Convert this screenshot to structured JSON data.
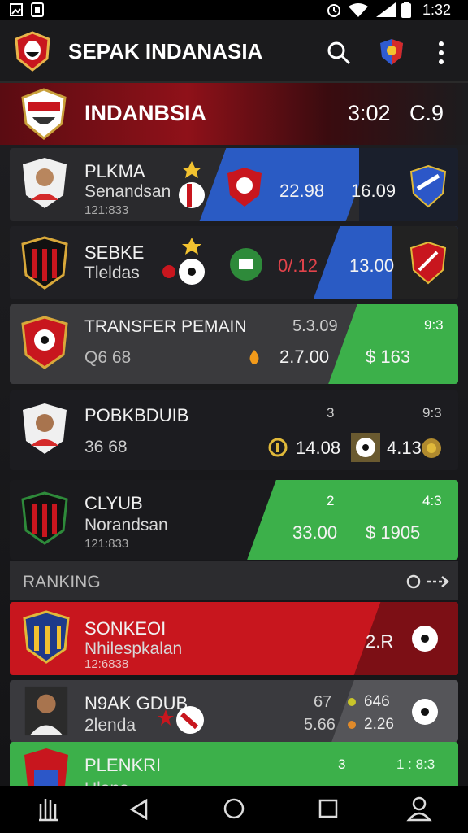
{
  "status_bar": {
    "time": "1:32"
  },
  "app_bar": {
    "title": "SEPAK INDANASIA"
  },
  "banner": {
    "title": "INDANBSIA",
    "score_left": "3:02",
    "score_right": "C.9"
  },
  "cards": [
    {
      "line1": "PLKMA",
      "line2": "Senandsan",
      "line3": "121:833",
      "value1": "22.98",
      "value2": "16.09"
    },
    {
      "line1": "SEBKE",
      "line2": "Tleldas",
      "value1": "0/.12",
      "value2": "13.00"
    },
    {
      "line1": "TRANSFER PEMAIN",
      "line2": "Q6 68",
      "top_value": "5.3.09",
      "value1": "2.7.00",
      "green_top": "9:3",
      "green_value": "$ 163"
    },
    {
      "line1": "POBKBDUIB",
      "line2": "36 68",
      "top_mid": "3",
      "top_right": "9:3",
      "value1": "14.08",
      "value2": "4.13"
    },
    {
      "line1": "CLYUB",
      "line2": "Norandsan",
      "line3": "121:833",
      "green_top": "2",
      "green_top2": "4:3",
      "green_value1": "33.00",
      "green_value2": "$ 1905"
    }
  ],
  "ranking": {
    "header": "RANKING",
    "items": [
      {
        "line1": "SONKEOI",
        "line2": "Nhilespkalan",
        "line3": "12:6838",
        "value": "2.R"
      },
      {
        "line1": "N9AK GDUB",
        "line2": "2lenda",
        "top_value": "67",
        "value": "5.66",
        "right_top": "646",
        "right_bottom": "2.26"
      },
      {
        "line1": "PLENKRI",
        "line2": "Ulana",
        "top_value": "3",
        "right_top": "1 : 8:3"
      }
    ]
  },
  "icons": {
    "status": [
      "gallery-icon",
      "sim-icon",
      "alarm-icon",
      "wifi-icon",
      "signal-icon",
      "battery-icon"
    ],
    "nav": [
      "recents-bars-icon",
      "back-icon",
      "home-icon",
      "overview-icon",
      "profile-icon"
    ]
  }
}
